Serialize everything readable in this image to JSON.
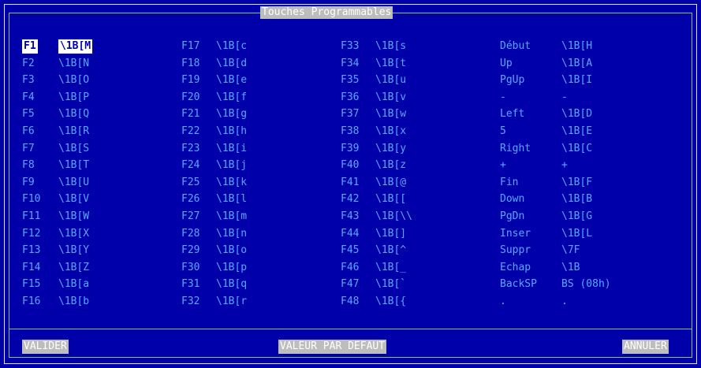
{
  "title": "Touches Programmables",
  "keys": [
    [
      {
        "name": "F1",
        "value": "\\1B[M",
        "selected": true
      },
      {
        "name": "F2",
        "value": "\\1B[N"
      },
      {
        "name": "F3",
        "value": "\\1B[O"
      },
      {
        "name": "F4",
        "value": "\\1B[P"
      },
      {
        "name": "F5",
        "value": "\\1B[Q"
      },
      {
        "name": "F6",
        "value": "\\1B[R"
      },
      {
        "name": "F7",
        "value": "\\1B[S"
      },
      {
        "name": "F8",
        "value": "\\1B[T"
      },
      {
        "name": "F9",
        "value": "\\1B[U"
      },
      {
        "name": "F10",
        "value": "\\1B[V"
      },
      {
        "name": "F11",
        "value": "\\1B[W"
      },
      {
        "name": "F12",
        "value": "\\1B[X"
      },
      {
        "name": "F13",
        "value": "\\1B[Y"
      },
      {
        "name": "F14",
        "value": "\\1B[Z"
      },
      {
        "name": "F15",
        "value": "\\1B[a"
      },
      {
        "name": "F16",
        "value": "\\1B[b"
      }
    ],
    [
      {
        "name": "F17",
        "value": "\\1B[c"
      },
      {
        "name": "F18",
        "value": "\\1B[d"
      },
      {
        "name": "F19",
        "value": "\\1B[e"
      },
      {
        "name": "F20",
        "value": "\\1B[f"
      },
      {
        "name": "F21",
        "value": "\\1B[g"
      },
      {
        "name": "F22",
        "value": "\\1B[h"
      },
      {
        "name": "F23",
        "value": "\\1B[i"
      },
      {
        "name": "F24",
        "value": "\\1B[j"
      },
      {
        "name": "F25",
        "value": "\\1B[k"
      },
      {
        "name": "F26",
        "value": "\\1B[l"
      },
      {
        "name": "F27",
        "value": "\\1B[m"
      },
      {
        "name": "F28",
        "value": "\\1B[n"
      },
      {
        "name": "F29",
        "value": "\\1B[o"
      },
      {
        "name": "F30",
        "value": "\\1B[p"
      },
      {
        "name": "F31",
        "value": "\\1B[q"
      },
      {
        "name": "F32",
        "value": "\\1B[r"
      }
    ],
    [
      {
        "name": "F33",
        "value": "\\1B[s"
      },
      {
        "name": "F34",
        "value": "\\1B[t"
      },
      {
        "name": "F35",
        "value": "\\1B[u"
      },
      {
        "name": "F36",
        "value": "\\1B[v"
      },
      {
        "name": "F37",
        "value": "\\1B[w"
      },
      {
        "name": "F38",
        "value": "\\1B[x"
      },
      {
        "name": "F39",
        "value": "\\1B[y"
      },
      {
        "name": "F40",
        "value": "\\1B[z"
      },
      {
        "name": "F41",
        "value": "\\1B[@"
      },
      {
        "name": "F42",
        "value": "\\1B[["
      },
      {
        "name": "F43",
        "value": "\\1B[\\\\"
      },
      {
        "name": "F44",
        "value": "\\1B[]"
      },
      {
        "name": "F45",
        "value": "\\1B[^"
      },
      {
        "name": "F46",
        "value": "\\1B[_"
      },
      {
        "name": "F47",
        "value": "\\1B[`"
      },
      {
        "name": "F48",
        "value": "\\1B[{"
      }
    ],
    [
      {
        "name": "Début",
        "value": "\\1B[H"
      },
      {
        "name": "Up",
        "value": "\\1B[A"
      },
      {
        "name": "PgUp",
        "value": "\\1B[I"
      },
      {
        "name": "-",
        "value": "-"
      },
      {
        "name": "Left",
        "value": "\\1B[D"
      },
      {
        "name": "5",
        "value": "\\1B[E"
      },
      {
        "name": "Right",
        "value": "\\1B[C"
      },
      {
        "name": "+",
        "value": "+"
      },
      {
        "name": "Fin",
        "value": "\\1B[F"
      },
      {
        "name": "Down",
        "value": "\\1B[B"
      },
      {
        "name": "PgDn",
        "value": "\\1B[G"
      },
      {
        "name": "Inser",
        "value": "\\1B[L"
      },
      {
        "name": "Suppr",
        "value": "\\7F"
      },
      {
        "name": "Echap",
        "value": "\\1B"
      },
      {
        "name": "BackSP",
        "value": "BS (08h)"
      },
      {
        "name": ".",
        "value": "."
      }
    ]
  ],
  "buttons": {
    "validate": "VALIDER",
    "default": "VALEUR PAR DEFAUT",
    "cancel": "ANNULER"
  },
  "colors": {
    "background": "#0000aa",
    "text": "#5aa8ff",
    "button_bg": "#bdbdbd",
    "button_text": "#ffffff"
  }
}
